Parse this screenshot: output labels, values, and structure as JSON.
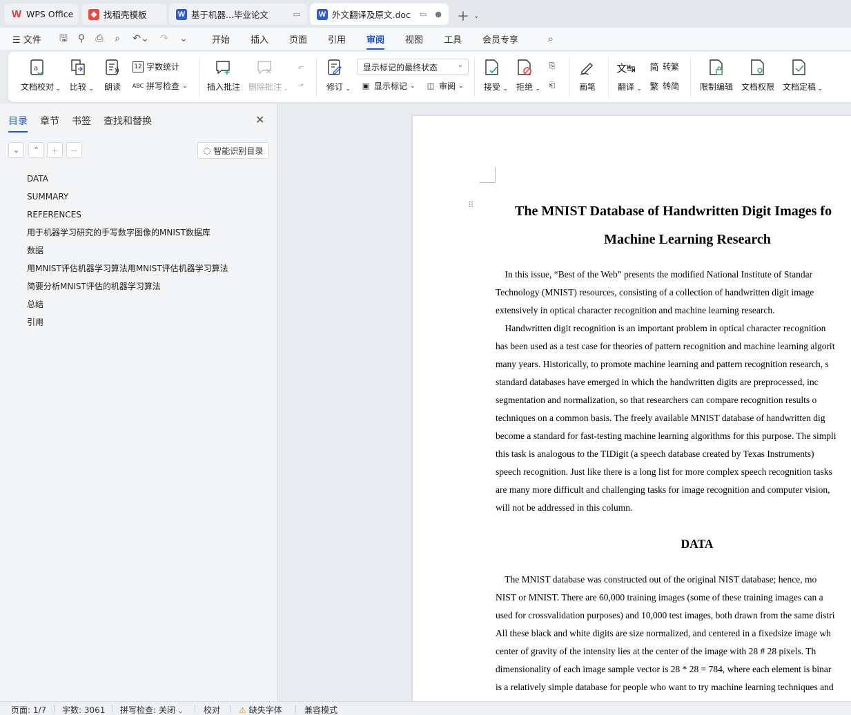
{
  "tabs": [
    {
      "label": "WPS Office",
      "icon": "wps-logo-icon"
    },
    {
      "label": "找稻壳模板",
      "icon": "docer-icon"
    },
    {
      "label": "基于机器...毕业论文",
      "icon": "word-doc-icon"
    },
    {
      "label": "外文翻译及原文.doc",
      "icon": "word-doc-icon"
    }
  ],
  "menu": {
    "file": "文件",
    "items": [
      "开始",
      "插入",
      "页面",
      "引用",
      "审阅",
      "视图",
      "工具",
      "会员专享"
    ],
    "active": "审阅"
  },
  "ribbon": {
    "proofread": "文档校对",
    "compare": "比较",
    "read_aloud": "朗读",
    "word_count": "字数统计",
    "spell_check": "拼写检查",
    "insert_comment": "插入批注",
    "delete_comment": "删除批注",
    "revise": "修订",
    "markup_state": "显示标记的最终状态",
    "show_markup": "显示标记",
    "review": "审阅",
    "accept": "接受",
    "reject": "拒绝",
    "pen": "画笔",
    "translate": "翻译",
    "to_traditional": "转繁",
    "to_simplified": "转简",
    "restrict_edit": "限制编辑",
    "doc_permission": "文档权限",
    "doc_finalize": "文档定稿"
  },
  "panel": {
    "tabs": [
      "目录",
      "章节",
      "书签",
      "查找和替换"
    ],
    "active_tab": "目录",
    "smart_toc": "智能识别目录",
    "toc": [
      "DATA",
      "SUMMARY",
      "REFERENCES",
      "用于机器学习研究的手写数字图像的MNIST数据库",
      "数据",
      "用MNIST评估机器学习算法用MNIST评估机器学习算法",
      "简要分析MNIST评估的机器学习算法",
      "总结",
      "引用"
    ]
  },
  "document": {
    "title_line1": "The MNIST Database of Handwritten Digit Images fo",
    "title_line2": "Machine Learning Research",
    "para1": [
      "    In this issue, “Best of the Web” presents the modified National Institute of Standar",
      "Technology (MNIST) resources, consisting of a collection of handwritten digit image",
      "extensively in optical character recognition and machine learning research."
    ],
    "para2": [
      "    Handwritten digit recognition is an important problem in optical character recognition",
      "has been used as a test case for theories of pattern recognition and machine learning algorit",
      "many years. Historically, to promote machine learning and pattern recognition research, s",
      "standard databases have emerged in which the handwritten digits are preprocessed, inc",
      "segmentation and normalization, so that researchers can compare recognition results o",
      "techniques on a common basis. The freely available MNIST database of handwritten dig",
      "become a standard for fast-testing machine learning algorithms for this purpose. The simpli",
      "this task is analogous to the TIDigit (a speech database created by Texas Instruments)",
      "speech recognition. Just like there is a long list for more complex speech recognition tasks",
      "are many more difficult and challenging tasks for image recognition and computer vision,",
      "will not be addressed in this column."
    ],
    "heading": "DATA",
    "para3": [
      "    The MNIST database was constructed out of the original NIST database; hence, mo",
      "NIST or MNIST. There are 60,000 training images (some of these training images can a",
      "used for crossvalidation purposes) and 10,000 test images, both drawn from the same distri",
      "All these black and white digits are size normalized, and centered in a fixedsize image wh",
      "center of gravity of the intensity lies at the center of the image with 28 # 28 pixels. Th",
      "dimensionality of each image sample vector is 28 * 28 = 784, where each element is binar",
      "is a relatively simple database for people who want to try machine learning techniques and"
    ]
  },
  "status": {
    "page": "页面: 1/7",
    "words": "字数: 3061",
    "spell": "拼写检查: 关闭",
    "proof": "校对",
    "missing_font": "缺失字体",
    "compat": "兼容模式"
  }
}
